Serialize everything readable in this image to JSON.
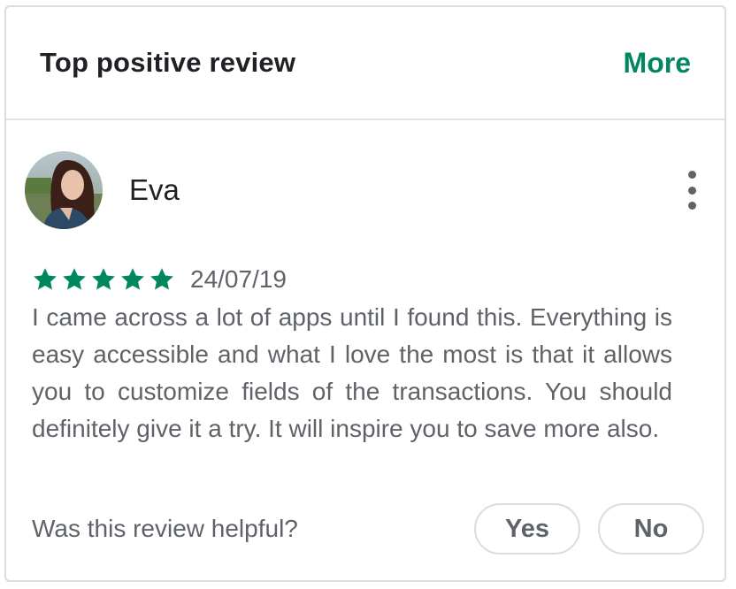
{
  "header": {
    "title": "Top positive review",
    "more_label": "More"
  },
  "review": {
    "reviewer_name": "Eva",
    "rating": 5,
    "rating_max": 5,
    "date": "24/07/19",
    "text": "I came across a lot of apps until I found this. Everything is easy accessible and what I love the most is that it allows you to customize fields of the transactions. You should definitely give it a try. It will inspire you to save more also.",
    "avatar_icon": "user-photo-avatar",
    "menu_icon": "more-vert-icon"
  },
  "helpful": {
    "question": "Was this review helpful?",
    "yes_label": "Yes",
    "no_label": "No"
  },
  "colors": {
    "accent": "#01875f",
    "star": "#01875f",
    "text_primary": "#202124",
    "text_secondary": "#5f6368"
  }
}
